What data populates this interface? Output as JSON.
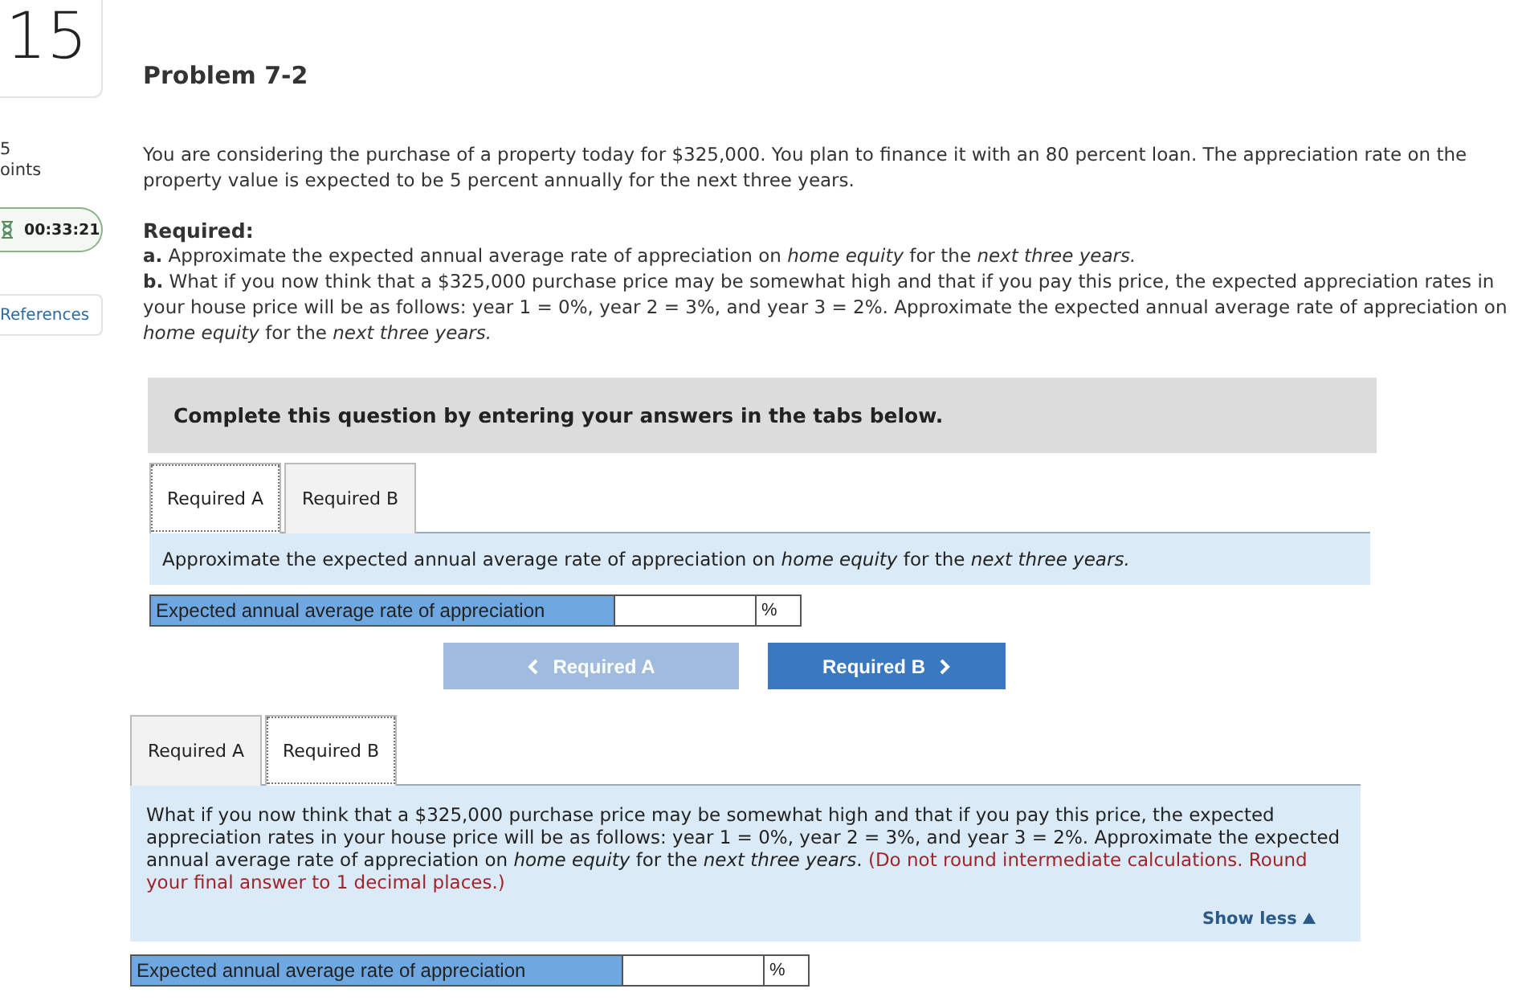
{
  "sidebar": {
    "question_number": "15",
    "points_value": "5",
    "points_label": "oints",
    "timer": "00:33:21",
    "references_button": "References"
  },
  "problem": {
    "title": "Problem 7-2",
    "intro": "You are considering the purchase of a property today for $325,000. You plan to finance it with an 80 percent loan. The appreciation rate on the property value is expected to be 5 percent annually for the next three years.",
    "required_heading": "Required:",
    "parts": [
      {
        "letter": "a.",
        "text": "Approximate the expected annual average rate of appreciation on *home equity* for the *next three years.*"
      },
      {
        "letter": "b.",
        "text": "What if you now think that a $325,000 purchase price may be somewhat high and that if you pay this price, the expected appreciation rates in your house price will be as follows: year 1 = 0%, year 2 = 3%, and year 3 = 2%. Approximate the expected annual average rate of appreciation on *home equity* for the *next three years.*"
      }
    ]
  },
  "banner": "Complete this question by entering your answers in the tabs below.",
  "sections": [
    {
      "tabs": [
        {
          "label": "Required A",
          "selected": true
        },
        {
          "label": "Required B",
          "selected": false
        }
      ],
      "instruction": "Approximate the expected annual average rate of appreciation on *home equity* for the *next three years.*",
      "answer": {
        "label": "Expected annual average rate of appreciation",
        "unit": "%"
      },
      "nav": [
        {
          "label": "Required A",
          "kind": "prev",
          "disabled": true
        },
        {
          "label": "Required B",
          "kind": "next",
          "disabled": false
        }
      ]
    },
    {
      "tabs": [
        {
          "label": "Required A",
          "selected": false
        },
        {
          "label": "Required B",
          "selected": true
        }
      ],
      "instruction": "What if you now think that a $325,000 purchase price may be somewhat high and that if you pay this price, the expected appreciation rates in your house price will be as follows: year 1 = 0%, year 2 = 3%, and year 3 = 2%. Approximate the expected annual average rate of appreciation on *home equity* for the *next three years*.",
      "note": "(Do not round intermediate calculations. Round your final answer to 1 decimal places.)",
      "show_less": "Show less",
      "answer": {
        "label": "Expected annual average rate of appreciation",
        "unit": "%"
      }
    }
  ]
}
